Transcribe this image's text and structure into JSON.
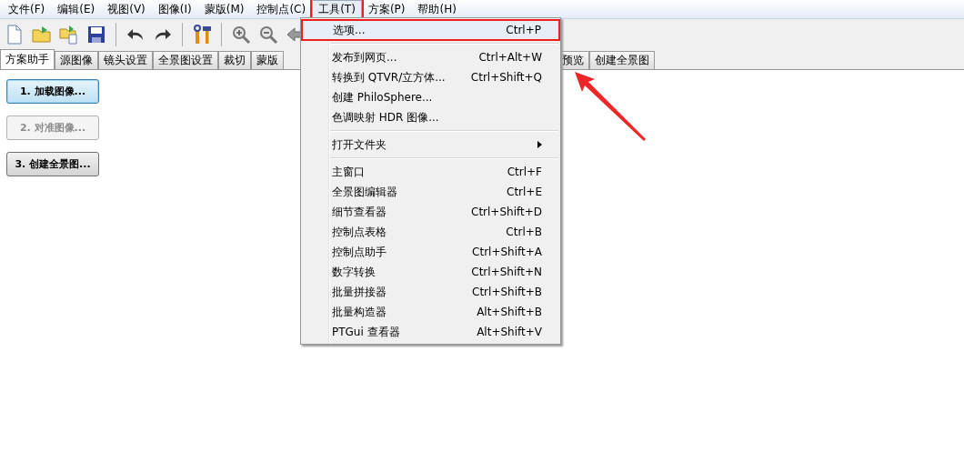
{
  "menubar": [
    {
      "label": "文件(F)",
      "selected": false
    },
    {
      "label": "编辑(E)",
      "selected": false
    },
    {
      "label": "视图(V)",
      "selected": false
    },
    {
      "label": "图像(I)",
      "selected": false
    },
    {
      "label": "蒙版(M)",
      "selected": false
    },
    {
      "label": "控制点(C)",
      "selected": false
    },
    {
      "label": "工具(T)",
      "selected": true
    },
    {
      "label": "方案(P)",
      "selected": false
    },
    {
      "label": "帮助(H)",
      "selected": false
    }
  ],
  "toolbar": [
    {
      "kind": "new"
    },
    {
      "kind": "open"
    },
    {
      "kind": "open-copy"
    },
    {
      "kind": "save"
    },
    {
      "kind": "sep"
    },
    {
      "kind": "undo"
    },
    {
      "kind": "redo"
    },
    {
      "kind": "sep"
    },
    {
      "kind": "tools"
    },
    {
      "kind": "sep"
    },
    {
      "kind": "zoom-in"
    },
    {
      "kind": "zoom-out"
    },
    {
      "kind": "back"
    }
  ],
  "tabs": [
    {
      "label": "方案助手",
      "selected": true
    },
    {
      "label": "源图像",
      "selected": false
    },
    {
      "label": "镜头设置",
      "selected": false
    },
    {
      "label": "全景图设置",
      "selected": false
    },
    {
      "label": "裁切",
      "selected": false
    },
    {
      "label": "蒙版",
      "selected": false
    },
    {
      "kind": "gap"
    },
    {
      "label": "预览",
      "selected": false
    },
    {
      "label": "创建全景图",
      "selected": false
    }
  ],
  "steps": [
    {
      "label": "1. 加载图像...",
      "disabled": false,
      "focused": true
    },
    {
      "label": "2. 对准图像...",
      "disabled": true,
      "focused": false
    },
    {
      "label": "3. 创建全景图...",
      "disabled": false,
      "focused": false
    }
  ],
  "dropdown": [
    {
      "kind": "item",
      "label": "选项...",
      "shortcut": "Ctrl+P",
      "selected": true
    },
    {
      "kind": "separator"
    },
    {
      "kind": "item",
      "label": "发布到网页...",
      "shortcut": "Ctrl+Alt+W",
      "selected": false
    },
    {
      "kind": "item",
      "label": "转换到 QTVR/立方体...",
      "shortcut": "Ctrl+Shift+Q",
      "selected": false
    },
    {
      "kind": "item",
      "label": "创建 PhiloSphere...",
      "selected": false
    },
    {
      "kind": "item",
      "label": "色调映射 HDR 图像...",
      "selected": false
    },
    {
      "kind": "separator"
    },
    {
      "kind": "submenu",
      "label": "打开文件夹",
      "selected": false
    },
    {
      "kind": "separator"
    },
    {
      "kind": "item",
      "label": "主窗口",
      "shortcut": "Ctrl+F",
      "selected": false
    },
    {
      "kind": "item",
      "label": "全景图编辑器",
      "shortcut": "Ctrl+E",
      "selected": false
    },
    {
      "kind": "item",
      "label": "细节查看器",
      "shortcut": "Ctrl+Shift+D",
      "selected": false
    },
    {
      "kind": "item",
      "label": "控制点表格",
      "shortcut": "Ctrl+B",
      "selected": false
    },
    {
      "kind": "item",
      "label": "控制点助手",
      "shortcut": "Ctrl+Shift+A",
      "selected": false
    },
    {
      "kind": "item",
      "label": "数字转换",
      "shortcut": "Ctrl+Shift+N",
      "selected": false
    },
    {
      "kind": "item",
      "label": "批量拼接器",
      "shortcut": "Ctrl+Shift+B",
      "selected": false
    },
    {
      "kind": "item",
      "label": "批量构造器",
      "shortcut": "Alt+Shift+B",
      "selected": false
    },
    {
      "kind": "item",
      "label": "PTGui 查看器",
      "shortcut": "Alt+Shift+V",
      "selected": false
    }
  ]
}
